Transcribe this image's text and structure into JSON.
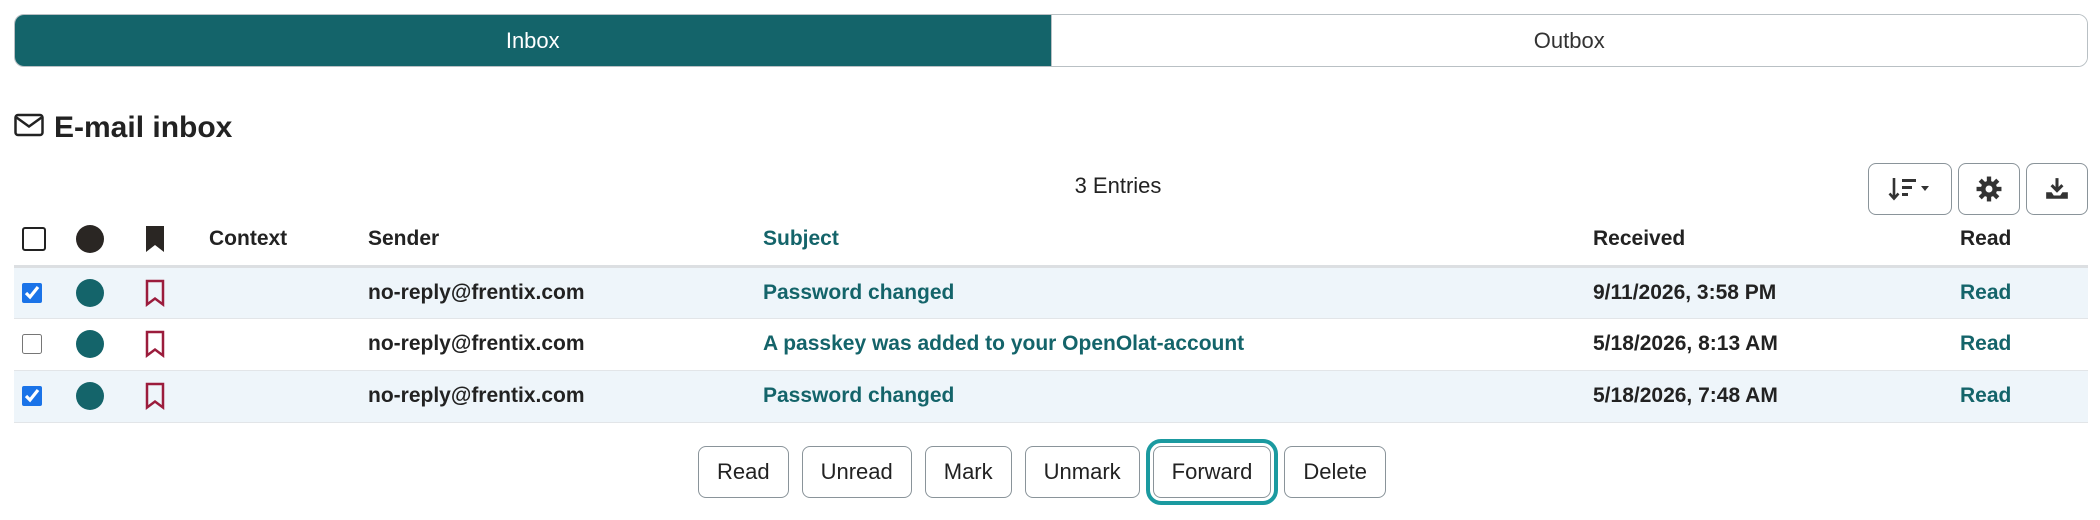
{
  "tabs": [
    {
      "label": "Inbox",
      "active": true
    },
    {
      "label": "Outbox",
      "active": false
    }
  ],
  "page": {
    "title": "E-mail inbox",
    "icon": "envelope-icon",
    "entries": "3 Entries"
  },
  "toolbar": {
    "sort_icon": "sort-descending-icon",
    "settings_icon": "gear-icon",
    "download_icon": "download-icon"
  },
  "table": {
    "columns": {
      "select": "",
      "status": "",
      "marked": "",
      "context": "Context",
      "sender": "Sender",
      "subject": "Subject",
      "received": "Received",
      "read": "Read"
    },
    "rows": [
      {
        "checked": true,
        "context": "",
        "sender": "no-reply@frentix.com",
        "subject": "Password changed",
        "received": "9/11/2026, 3:58 PM",
        "read": "Read"
      },
      {
        "checked": false,
        "context": "",
        "sender": "no-reply@frentix.com",
        "subject": "A passkey was added to your OpenOlat-account",
        "received": "5/18/2026, 8:13 AM",
        "read": "Read"
      },
      {
        "checked": true,
        "context": "",
        "sender": "no-reply@frentix.com",
        "subject": "Password changed",
        "received": "5/18/2026, 7:48 AM",
        "read": "Read"
      }
    ]
  },
  "actions": {
    "read": "Read",
    "unread": "Unread",
    "mark": "Mark",
    "unmark": "Unmark",
    "forward": "Forward",
    "delete": "Delete"
  },
  "colors": {
    "accent": "#14646a",
    "bookmark": "#9b1c3c",
    "selected_row": "#eef5fa",
    "focus_ring": "#1b9aa0"
  }
}
